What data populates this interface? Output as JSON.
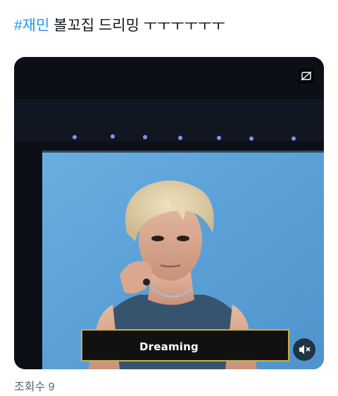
{
  "post": {
    "hashtag": "#재민",
    "text": " 볼꼬집 드리밍 ㅜㅜㅜㅜㅜㅜ",
    "views": "조회수 9"
  },
  "media": {
    "caption": "Dreaming",
    "gif_icon": "gif-settings-icon",
    "mute_icon": "speaker-muted-icon"
  },
  "colors": {
    "hashtag": "#1d9bf0",
    "text": "#0f1419",
    "muted_text": "#536471",
    "screen_blue": "#5fa3d8"
  }
}
